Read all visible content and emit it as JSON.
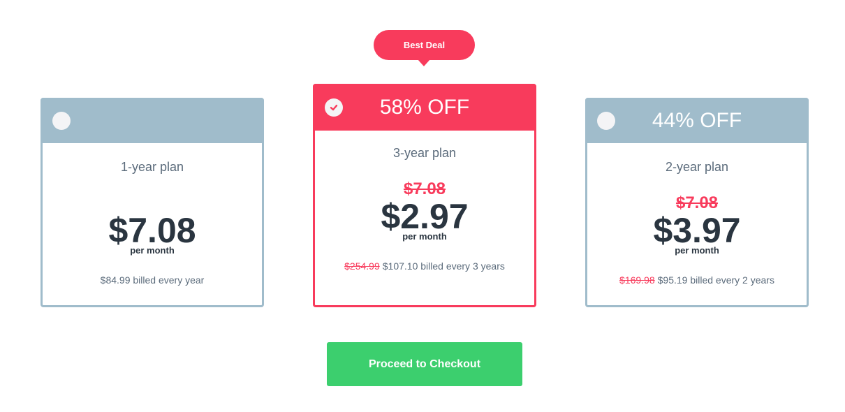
{
  "badge": {
    "label": "Best Deal"
  },
  "colors": {
    "accent": "#f83b5c",
    "plan_header": "#a0bccb",
    "checkout": "#3ccf6e",
    "price_text": "#2a3540"
  },
  "plans": [
    {
      "header_label": "",
      "selected": false,
      "name": "1-year plan",
      "old_monthly": "",
      "monthly": "$7.08",
      "per_label": "per month",
      "old_total": "",
      "billed": "$84.99 billed every year"
    },
    {
      "header_label": "58% OFF",
      "selected": true,
      "name": "3-year plan",
      "old_monthly": "$7.08",
      "monthly": "$2.97",
      "per_label": "per month",
      "old_total": "$254.99",
      "billed": "$107.10 billed every 3 years"
    },
    {
      "header_label": "44% OFF",
      "selected": false,
      "name": "2-year plan",
      "old_monthly": "$7.08",
      "monthly": "$3.97",
      "per_label": "per month",
      "old_total": "$169.98",
      "billed": "$95.19 billed every 2 years"
    }
  ],
  "checkout": {
    "label": "Proceed to Checkout"
  }
}
